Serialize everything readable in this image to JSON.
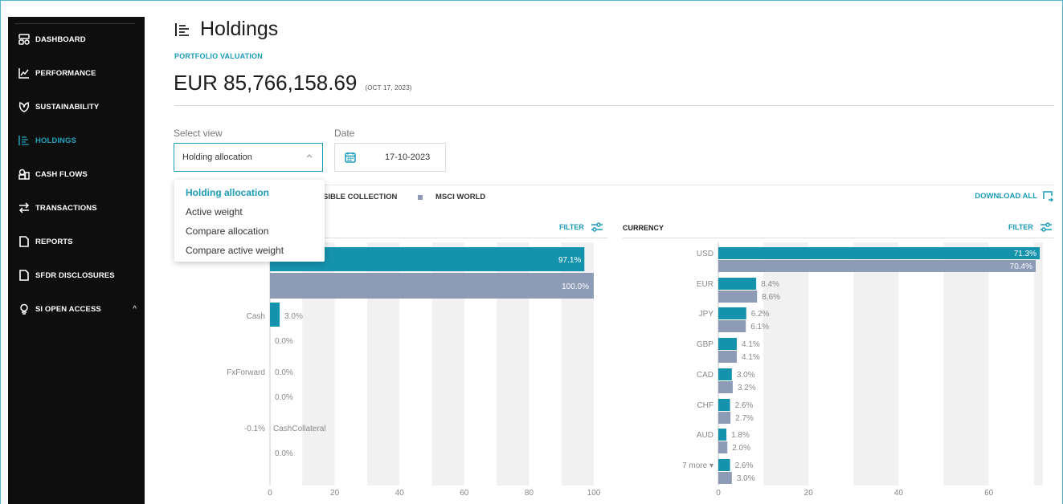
{
  "sidebar": {
    "items": [
      {
        "label": "DASHBOARD",
        "icon": "dashboard-icon"
      },
      {
        "label": "PERFORMANCE",
        "icon": "performance-chart-icon"
      },
      {
        "label": "SUSTAINABILITY",
        "icon": "leaf-icon"
      },
      {
        "label": "HOLDINGS",
        "icon": "holdings-list-icon",
        "active": true
      },
      {
        "label": "CASH FLOWS",
        "icon": "cash-flows-icon"
      },
      {
        "label": "TRANSACTIONS",
        "icon": "transactions-arrows-icon"
      },
      {
        "label": "REPORTS",
        "icon": "document-icon"
      },
      {
        "label": "SFDR DISCLOSURES",
        "icon": "document-icon"
      },
      {
        "label": "SI OPEN ACCESS",
        "icon": "lightbulb-icon",
        "caret": "^"
      }
    ]
  },
  "header": {
    "title": "Holdings",
    "subtitle": "PORTFOLIO VALUATION",
    "amount": "EUR 85,766,158.69",
    "as_of": "(OCT 17, 2023)"
  },
  "controls": {
    "view_label": "Select view",
    "view_value": "Holding allocation",
    "date_label": "Date",
    "date_value": "17-10-2023"
  },
  "dropdown": {
    "options": [
      "Holding allocation",
      "Active weight",
      "Compare allocation",
      "Compare active weight"
    ],
    "selected": 0
  },
  "legend": {
    "series1": "SIBLE COLLECTION",
    "series2": "MSCI WORLD",
    "download": "DOWNLOAD ALL"
  },
  "panels": {
    "left_filter": "FILTER",
    "right_title": "CURRENCY",
    "right_filter": "FILTER"
  },
  "colors": {
    "accent": "#1a9bb8",
    "series1": "#1593ad",
    "series2": "#8d9bb7",
    "sidebar_bg": "#0e0e0e"
  },
  "chart_data": [
    {
      "type": "bar",
      "orientation": "horizontal",
      "categories": [
        "",
        "Cash",
        "FxForward",
        "CashCollateral"
      ],
      "series": [
        {
          "values": [
            97.1,
            3.0,
            0.0,
            -0.1
          ],
          "labels": [
            "97.1%",
            "3.0%",
            "0.0%",
            "-0.1%"
          ]
        },
        {
          "values": [
            100.0,
            0.0,
            0.0,
            0.0
          ],
          "labels": [
            "100.0%",
            "0.0%",
            "0.0%",
            "0.0%"
          ]
        }
      ],
      "xlim": [
        0,
        100
      ],
      "xticks": [
        "0",
        "20",
        "40",
        "60",
        "80",
        "100"
      ]
    },
    {
      "type": "bar",
      "orientation": "horizontal",
      "title": "CURRENCY",
      "categories": [
        "USD",
        "EUR",
        "JPY",
        "GBP",
        "CAD",
        "CHF",
        "AUD",
        "7 more ▾"
      ],
      "series": [
        {
          "values": [
            71.3,
            8.4,
            6.2,
            4.1,
            3.0,
            2.6,
            1.8,
            2.6
          ],
          "labels": [
            "71.3%",
            "8.4%",
            "6.2%",
            "4.1%",
            "3.0%",
            "2.6%",
            "1.8%",
            "2.6%"
          ]
        },
        {
          "values": [
            70.4,
            8.6,
            6.1,
            4.1,
            3.2,
            2.7,
            2.0,
            3.0
          ],
          "labels": [
            "70.4%",
            "8.6%",
            "6.1%",
            "4.1%",
            "3.2%",
            "2.7%",
            "2.0%",
            "3.0%"
          ]
        }
      ],
      "xlim": [
        0,
        72
      ],
      "xticks": [
        "0",
        "20",
        "40",
        "60"
      ]
    }
  ]
}
